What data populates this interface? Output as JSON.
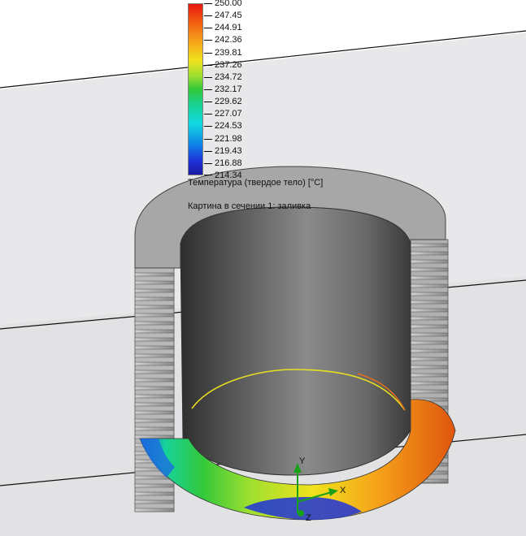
{
  "legend": {
    "values": [
      "250.00",
      "247.45",
      "244.91",
      "242.36",
      "239.81",
      "237.26",
      "234.72",
      "232.17",
      "229.62",
      "227.07",
      "224.53",
      "221.98",
      "219.43",
      "216.88",
      "214.34"
    ],
    "title": "Температура (твердое тело) [°C]",
    "subtitle": "Картина в сечении 1: заливка"
  },
  "triad": {
    "x_label": "X",
    "y_label": "Y",
    "z_label": "Z"
  },
  "colors": {
    "background": "#ffffff",
    "cylinder": "#5a5a5a",
    "fins": "#9a9a9a",
    "hot": "#e8170e",
    "cold": "#1b1b9e"
  }
}
